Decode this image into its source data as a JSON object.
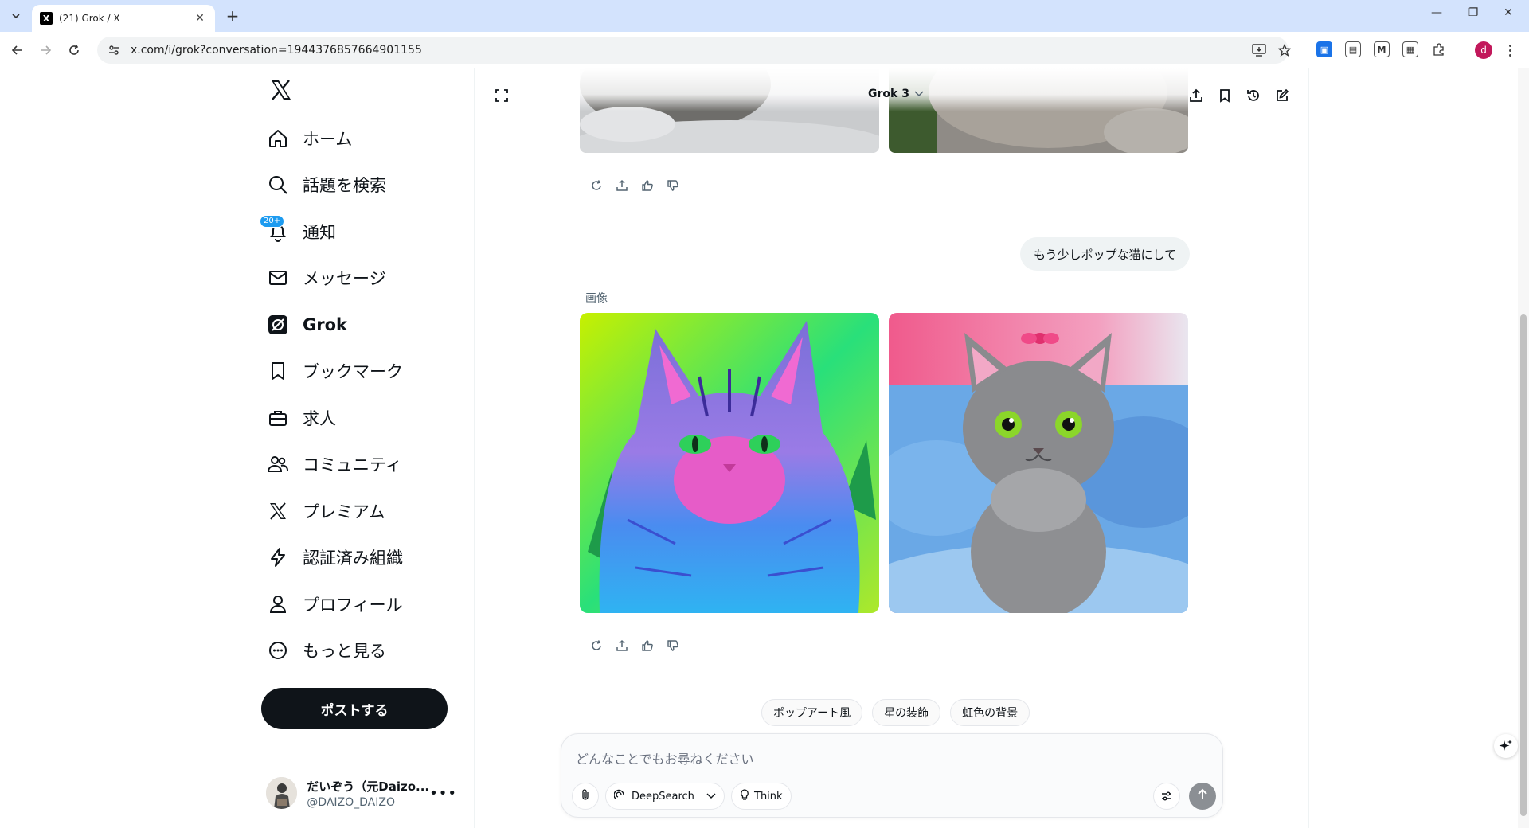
{
  "browser": {
    "tab_title": "(21) Grok / X",
    "url": "x.com/i/grok?conversation=1944376857664901155",
    "profile_initial": "d"
  },
  "sidebar": {
    "items": [
      {
        "label": "ホーム",
        "icon": "home-icon"
      },
      {
        "label": "話題を検索",
        "icon": "search-icon"
      },
      {
        "label": "通知",
        "icon": "bell-icon",
        "badge": "20+"
      },
      {
        "label": "メッセージ",
        "icon": "mail-icon"
      },
      {
        "label": "Grok",
        "icon": "grok-icon",
        "active": true
      },
      {
        "label": "ブックマーク",
        "icon": "bookmark-icon"
      },
      {
        "label": "求人",
        "icon": "briefcase-icon"
      },
      {
        "label": "コミュニティ",
        "icon": "people-icon"
      },
      {
        "label": "プレミアム",
        "icon": "x-icon"
      },
      {
        "label": "認証済み組織",
        "icon": "lightning-icon"
      },
      {
        "label": "プロフィール",
        "icon": "person-icon"
      },
      {
        "label": "もっと見る",
        "icon": "more-circle-icon"
      }
    ],
    "post_button": "ポストする",
    "account": {
      "name": "だいぞう（元Daizo...",
      "handle": "@DAIZO_DAIZO"
    }
  },
  "grok": {
    "model": "Grok 3",
    "user_message": "もう少しポップな猫にして",
    "image_label": "画像",
    "suggestions": [
      "ポップアート風",
      "星の装飾",
      "虹色の背景"
    ],
    "composer": {
      "placeholder": "どんなことでもお尋ねください",
      "deepsearch_label": "DeepSearch",
      "think_label": "Think"
    }
  },
  "colors": {
    "accent": "#1d9bf0",
    "post_button": "#0f1419"
  }
}
